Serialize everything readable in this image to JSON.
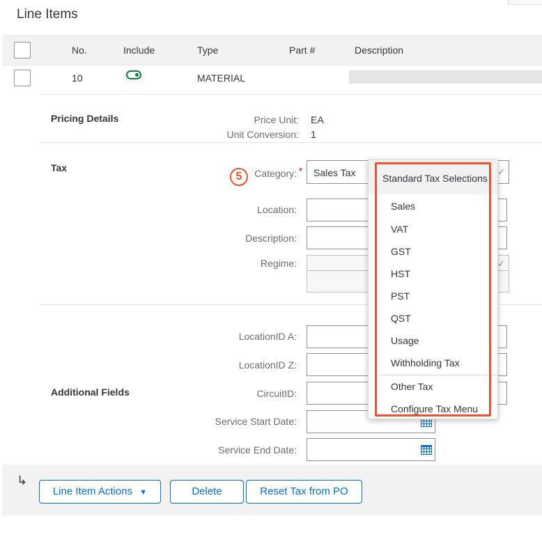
{
  "page": {
    "title": "Line Items"
  },
  "table": {
    "columns": [
      "No.",
      "Include",
      "Type",
      "Part #",
      "Description"
    ],
    "row": {
      "no": "10",
      "type": "MATERIAL",
      "include": true
    }
  },
  "pricing": {
    "section_label": "Pricing Details",
    "price_unit_label": "Price Unit:",
    "price_unit_value": "EA",
    "unit_conversion_label": "Unit Conversion:",
    "unit_conversion_value": "1"
  },
  "tax": {
    "section_label": "Tax",
    "step_number": "5",
    "category_label": "Category:",
    "required_marker": "*",
    "category_value": "Sales Tax",
    "location_label": "Location:",
    "description_label": "Description:",
    "regime_label": "Regime:"
  },
  "dropdown": {
    "header": "Standard Tax Selections",
    "items": [
      "Sales",
      "VAT",
      "GST",
      "HST",
      "PST",
      "QST",
      "Usage",
      "Withholding Tax"
    ],
    "extra_items": [
      "Other Tax",
      "Configure Tax Menu"
    ]
  },
  "additional": {
    "section_label": "Additional Fields",
    "location_a_label": "LocationID A:",
    "location_z_label": "LocationID Z:",
    "circuit_label": "CircuitID:",
    "start_date_label": "Service Start Date:",
    "end_date_label": "Service End Date:"
  },
  "footer": {
    "line_item_actions": "Line Item Actions",
    "delete": "Delete",
    "reset_tax": "Reset Tax from PO"
  },
  "colors": {
    "accent": "#0a6ed1",
    "highlight": "#e9542f",
    "toggle_on": "#107e3e"
  }
}
